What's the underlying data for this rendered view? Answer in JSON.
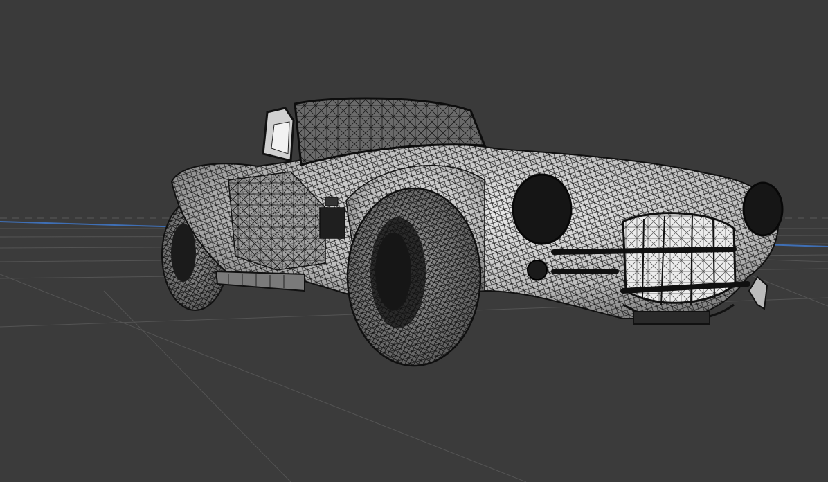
{
  "viewport": {
    "kind": "3d-wireframe-viewport",
    "subject": "roadster-car-wireframe-mesh",
    "colors": {
      "background": "#3a3a3a",
      "floor": "#3c3c3c",
      "grid_line": "#555555",
      "axis_x": "#3f6fb5",
      "axis_y": "#b55555",
      "mesh_fill": "#cfcfcf",
      "mesh_line": "#1a1a1a",
      "tire": "#7e7e7e"
    },
    "shading": "wireframe-over-solid",
    "show_grid": true
  }
}
